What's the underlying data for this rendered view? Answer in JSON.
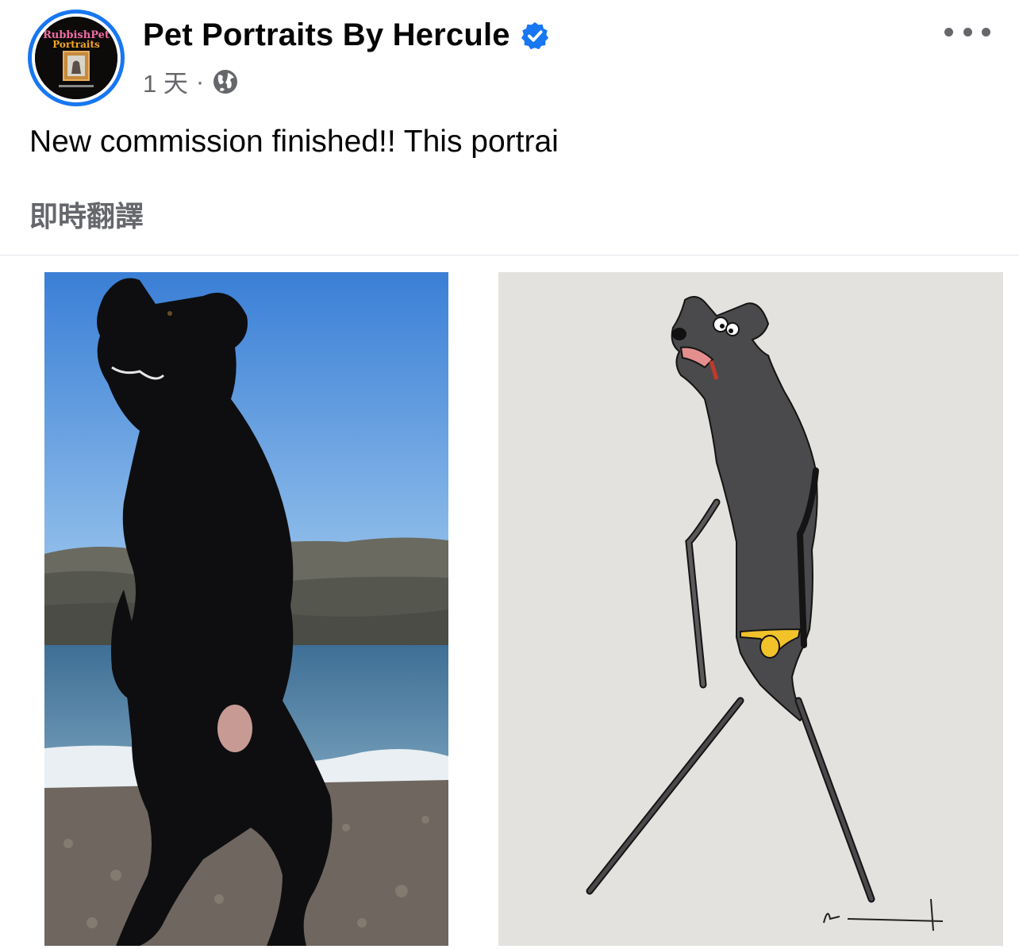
{
  "post": {
    "page_name": "Pet Portraits By Hercule",
    "time": "1 天",
    "separator": "·",
    "text": "New commission finished!! This portrai",
    "translate_label": "即時翻譯"
  },
  "avatar": {
    "logo_line1": "RubbishPet",
    "logo_line2": "Portraits"
  },
  "photos": [
    {
      "type": "photograph",
      "subject": "black dog standing on hind legs on a pebble beach"
    },
    {
      "type": "drawing",
      "subject": "pencil drawing of the same dog standing, wearing yellow underwear"
    }
  ],
  "colors": {
    "verified": "#1877f2",
    "secondary_text": "#65676b",
    "ring": "#1877f2"
  },
  "icons": [
    "verified-badge-icon",
    "globe-icon",
    "more-options-icon"
  ]
}
